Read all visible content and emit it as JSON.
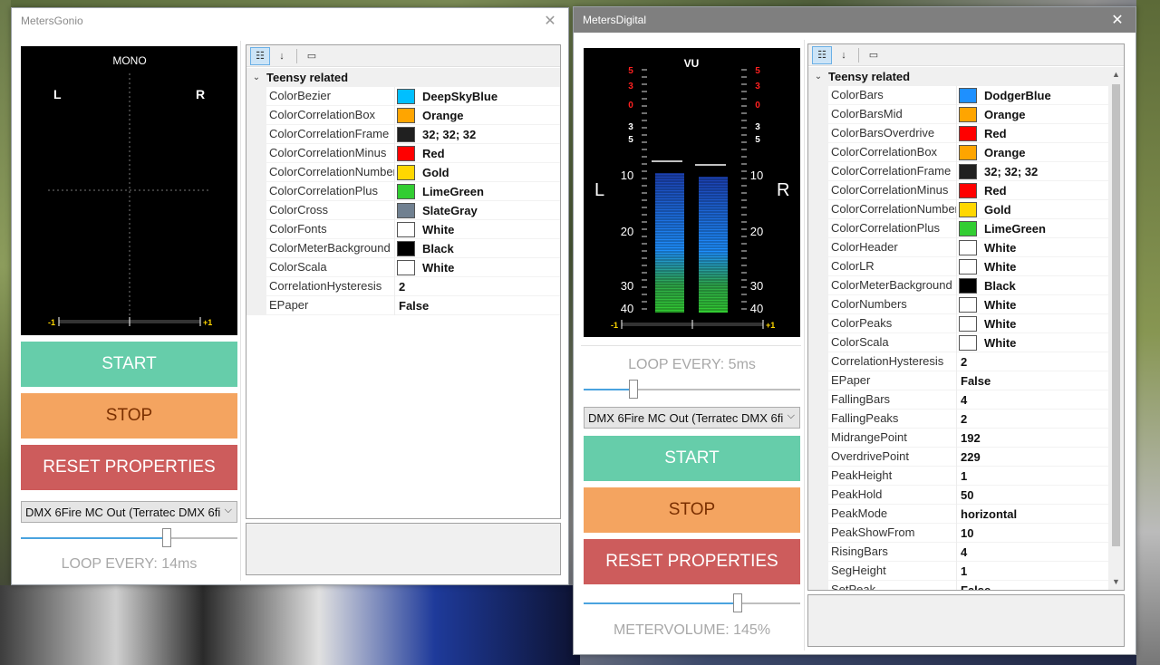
{
  "window1": {
    "title": "MetersGonio",
    "meter": {
      "title": "MONO",
      "left": "L",
      "right": "R",
      "scale_min": "-1",
      "scale_max": "+1"
    },
    "buttons": {
      "start": "START",
      "stop": "STOP",
      "reset": "RESET PROPERTIES"
    },
    "device": "DMX 6Fire MC Out (Terratec DMX 6fi",
    "loop_label": "LOOP EVERY: 14ms",
    "loop_slider_fraction": 0.68,
    "grid": {
      "category": "Teensy related",
      "rows": [
        {
          "name": "ColorBezier",
          "value": "DeepSkyBlue",
          "color": "#00bfff"
        },
        {
          "name": "ColorCorrelationBox",
          "value": "Orange",
          "color": "#ffa500"
        },
        {
          "name": "ColorCorrelationFrame",
          "value": "32; 32; 32",
          "color": "#202020"
        },
        {
          "name": "ColorCorrelationMinus",
          "value": "Red",
          "color": "#ff0000"
        },
        {
          "name": "ColorCorrelationNumbers",
          "value": "Gold",
          "color": "#ffd700"
        },
        {
          "name": "ColorCorrelationPlus",
          "value": "LimeGreen",
          "color": "#32cd32"
        },
        {
          "name": "ColorCross",
          "value": "SlateGray",
          "color": "#708090"
        },
        {
          "name": "ColorFonts",
          "value": "White",
          "color": "#ffffff"
        },
        {
          "name": "ColorMeterBackground",
          "value": "Black",
          "color": "#000000"
        },
        {
          "name": "ColorScala",
          "value": "White",
          "color": "#ffffff"
        },
        {
          "name": "CorrelationHysteresis",
          "value": "2",
          "color": ""
        },
        {
          "name": "EPaper",
          "value": "False",
          "color": ""
        }
      ]
    }
  },
  "window2": {
    "title": "MetersDigital",
    "meter": {
      "title": "VU",
      "left": "L",
      "right": "R",
      "red_ticks": [
        "5",
        "3",
        "0"
      ],
      "white_ticks": [
        "3",
        "5",
        "10",
        "20",
        "30",
        "40"
      ],
      "scale_min": "-1",
      "scale_max": "+1",
      "bars": [
        {
          "channel": "L",
          "level": 0.7
        },
        {
          "channel": "R",
          "level": 0.68
        }
      ]
    },
    "loop_label": "LOOP EVERY: 5ms",
    "loop_slider_fraction": 0.22,
    "device": "DMX 6Fire MC Out (Terratec DMX 6fi",
    "buttons": {
      "start": "START",
      "stop": "STOP",
      "reset": "RESET PROPERTIES"
    },
    "volume_label": "METERVOLUME: 145%",
    "volume_slider_fraction": 0.72,
    "grid": {
      "category": "Teensy related",
      "rows": [
        {
          "name": "ColorBars",
          "value": "DodgerBlue",
          "color": "#1e90ff"
        },
        {
          "name": "ColorBarsMid",
          "value": "Orange",
          "color": "#ffa500"
        },
        {
          "name": "ColorBarsOverdrive",
          "value": "Red",
          "color": "#ff0000"
        },
        {
          "name": "ColorCorrelationBox",
          "value": "Orange",
          "color": "#ffa500"
        },
        {
          "name": "ColorCorrelationFrame",
          "value": "32; 32; 32",
          "color": "#202020"
        },
        {
          "name": "ColorCorrelationMinus",
          "value": "Red",
          "color": "#ff0000"
        },
        {
          "name": "ColorCorrelationNumbers",
          "value": "Gold",
          "color": "#ffd700"
        },
        {
          "name": "ColorCorrelationPlus",
          "value": "LimeGreen",
          "color": "#32cd32"
        },
        {
          "name": "ColorHeader",
          "value": "White",
          "color": "#ffffff"
        },
        {
          "name": "ColorLR",
          "value": "White",
          "color": "#ffffff"
        },
        {
          "name": "ColorMeterBackground",
          "value": "Black",
          "color": "#000000"
        },
        {
          "name": "ColorNumbers",
          "value": "White",
          "color": "#ffffff"
        },
        {
          "name": "ColorPeaks",
          "value": "White",
          "color": "#ffffff"
        },
        {
          "name": "ColorScala",
          "value": "White",
          "color": "#ffffff"
        },
        {
          "name": "CorrelationHysteresis",
          "value": "2",
          "color": ""
        },
        {
          "name": "EPaper",
          "value": "False",
          "color": ""
        },
        {
          "name": "FallingBars",
          "value": "4",
          "color": ""
        },
        {
          "name": "FallingPeaks",
          "value": "2",
          "color": ""
        },
        {
          "name": "MidrangePoint",
          "value": "192",
          "color": ""
        },
        {
          "name": "OverdrivePoint",
          "value": "229",
          "color": ""
        },
        {
          "name": "PeakHeight",
          "value": "1",
          "color": ""
        },
        {
          "name": "PeakHold",
          "value": "50",
          "color": ""
        },
        {
          "name": "PeakMode",
          "value": "horizontal",
          "color": ""
        },
        {
          "name": "PeakShowFrom",
          "value": "10",
          "color": ""
        },
        {
          "name": "RisingBars",
          "value": "4",
          "color": ""
        },
        {
          "name": "SegHeight",
          "value": "1",
          "color": ""
        },
        {
          "name": "SetPeak",
          "value": "False",
          "color": ""
        }
      ]
    }
  }
}
